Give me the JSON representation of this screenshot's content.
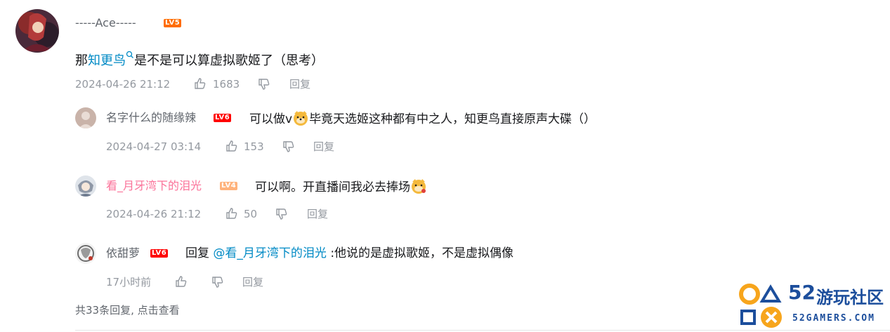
{
  "main_comment": {
    "username": "-----Ace-----",
    "level": "LV5",
    "text_prefix": "那",
    "link_text": "知更鸟",
    "text_suffix": "是不是可以算虚拟歌姬了（思考）",
    "timestamp": "2024-04-26 21:12",
    "likes": "1683",
    "reply_label": "回复"
  },
  "replies": [
    {
      "username": "名字什么的随缘辣",
      "level": "LV6",
      "text_prefix": "可以做v",
      "text_suffix": "毕竟天选姬这种都有中之人，知更鸟直接原声大碟（）",
      "timestamp": "2024-04-27 03:14",
      "likes": "153",
      "reply_label": "回复"
    },
    {
      "username": "看_月牙湾下的泪光",
      "level": "LV4",
      "text_prefix": "可以啊。开直播间我必去捧场",
      "timestamp": "2024-04-26 21:12",
      "likes": "50",
      "reply_label": "回复"
    },
    {
      "username": "依甜萝",
      "level": "LV6",
      "reply_word": "回复",
      "mention": "@看_月牙湾下的泪光",
      "text_suffix": ":他说的是虚拟歌姬，不是虚拟偶像",
      "timestamp": "17小时前",
      "likes": "",
      "reply_label": "回复"
    }
  ],
  "footer": {
    "more_replies": "共33条回复, 点击查看"
  },
  "watermark": {
    "number": "52",
    "name": "游玩社区",
    "url": "52GAMERS.COM"
  },
  "colors": {
    "lv4": "#ffb37c",
    "lv5": "#ff6c00",
    "lv6": "#ff0000",
    "pink_name": "#fb7299",
    "link": "#008ac5",
    "meta": "#9499a0",
    "logo_orange": "#f7a51c",
    "logo_blue": "#1c4e9c"
  }
}
